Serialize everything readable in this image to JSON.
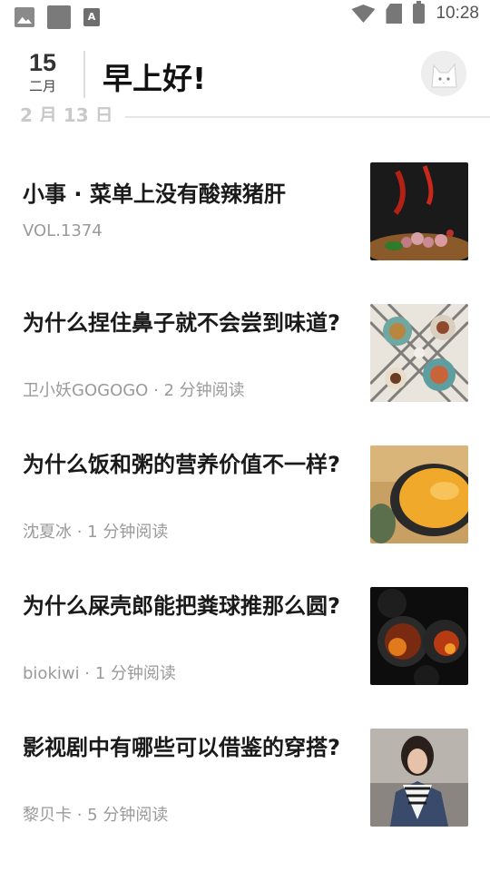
{
  "status_bar": {
    "time": "10:28",
    "a_icon": "A",
    "icons": [
      "image-icon",
      "app-square-icon",
      "a-app-icon",
      "wifi-icon",
      "no-sim-icon",
      "battery-icon"
    ]
  },
  "header": {
    "day": "15",
    "month": "二月",
    "greeting": "早上好!"
  },
  "section": {
    "date": "2 月 13 日"
  },
  "articles": [
    {
      "title": "小事 · 菜单上没有酸辣猪肝",
      "meta": "VOL.1374"
    },
    {
      "title": "为什么捏住鼻子就不会尝到味道?",
      "meta": "卫小妖GOGOGO · 2 分钟阅读"
    },
    {
      "title": "为什么饭和粥的营养价值不一样?",
      "meta": "沈夏冰 · 1 分钟阅读"
    },
    {
      "title": "为什么屎壳郎能把粪球推那么圆?",
      "meta": "biokiwi · 1 分钟阅读"
    },
    {
      "title": "影视剧中有哪些可以借鉴的穿搭?",
      "meta": "黎贝卡 · 5 分钟阅读"
    }
  ]
}
